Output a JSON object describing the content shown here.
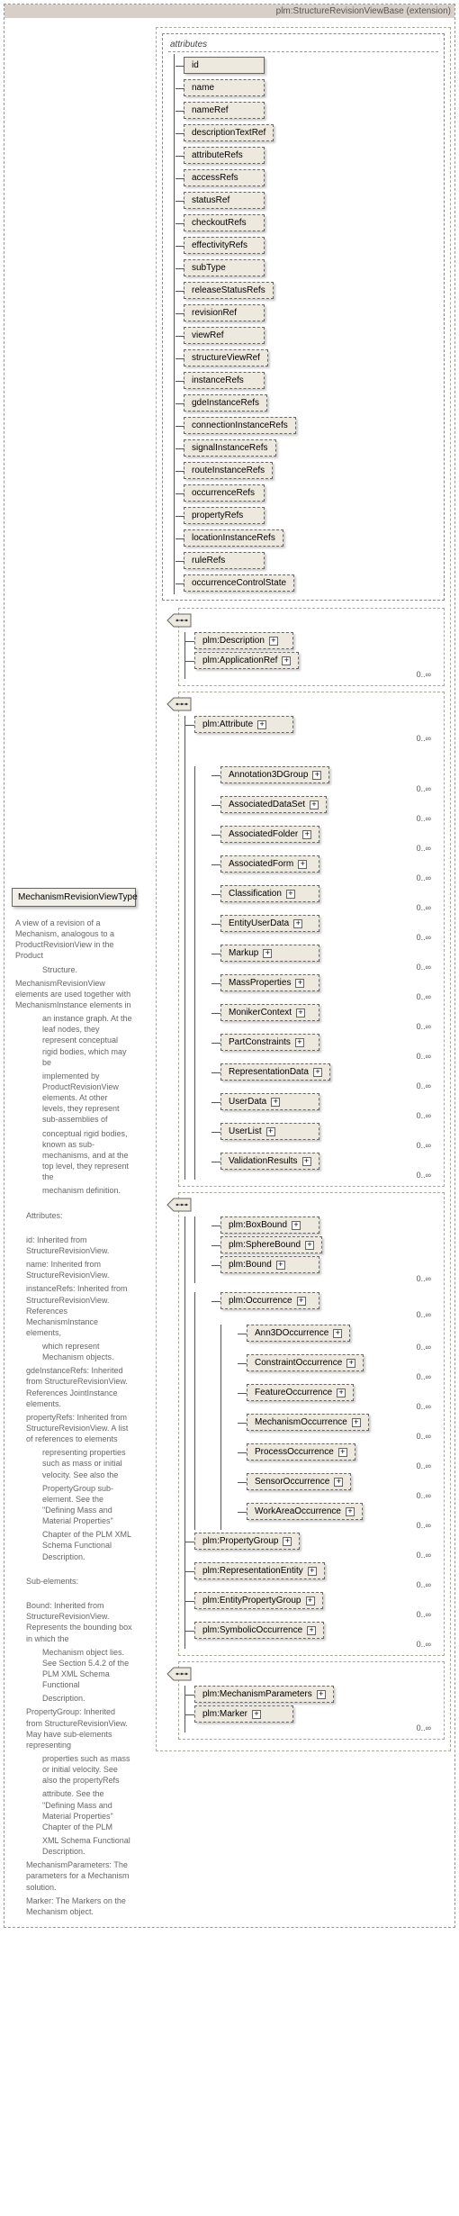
{
  "extension_label": "plm:StructureRevisionViewBase (extension)",
  "type_name": "MechanismRevisionViewType",
  "desc": {
    "p1": "A view of a revision of a Mechanism, analogous to a ProductRevisionView in the Product",
    "p1b": "Structure.",
    "p2": "MechanismRevisionView elements are used together with MechanismInstance elements in",
    "p2b": "an instance graph. At the leaf nodes, they represent conceptual rigid bodies, which may be",
    "p2c": "implemented by ProductRevisionView elements. At other levels, they represent sub-assemblies of",
    "p2d": "conceptual rigid bodies, known as sub-mechanisms, and at the top level, they represent the",
    "p2e": "mechanism definition.",
    "attr_header": "Attributes:",
    "a_id": "id:            Inherited from StructureRevisionView.",
    "a_name": "name:          Inherited from StructureRevisionView.",
    "a_inst": "instanceRefs:  Inherited from StructureRevisionView. References MechanismInstance elements,",
    "a_inst2": "which represent Mechanism objects.",
    "a_gde": "gdeInstanceRefs: Inherited from StructureRevisionView. References JointInstance elements.",
    "a_prop": "propertyRefs:  Inherited from StructureRevisionView. A list of references to elements",
    "a_prop2": "representing properties such as mass or initial velocity. See also the",
    "a_prop3": "PropertyGroup sub-element. See the \"Defining Mass and Material Properties\"",
    "a_prop4": "Chapter of the PLM XML Schema Functional Description.",
    "sub_header": "Sub-elements:",
    "s_bound": "Bound:         Inherited from StructureRevisionView. Represents the bounding box in which the",
    "s_bound2": "Mechanism object lies. See Section 5.4.2 of the PLM XML Schema Functional",
    "s_bound3": "Description.",
    "s_pg": "PropertyGroup: Inherited from StructureRevisionView. May have sub-elements representing",
    "s_pg2": "properties such as mass or initial velocity. See also the propertyRefs",
    "s_pg3": "attribute. See the \"Defining Mass and  Material Properties\" Chapter of the PLM",
    "s_pg4": "XML Schema Functional Description.",
    "s_mp": "MechanismParameters: The parameters for a Mechanism solution.",
    "s_mk": "Marker:        The Markers on the Mechanism object."
  },
  "attributes_title": "attributes",
  "attrs": {
    "id": "id",
    "name": "name",
    "nameRef": "nameRef",
    "descriptionTextRef": "descriptionTextRef",
    "attributeRefs": "attributeRefs",
    "accessRefs": "accessRefs",
    "statusRef": "statusRef",
    "checkoutRefs": "checkoutRefs",
    "effectivityRefs": "effectivityRefs",
    "subType": "subType",
    "releaseStatusRefs": "releaseStatusRefs",
    "revisionRef": "revisionRef",
    "viewRef": "viewRef",
    "structureViewRef": "structureViewRef",
    "instanceRefs": "instanceRefs",
    "gdeInstanceRefs": "gdeInstanceRefs",
    "connectionInstanceRefs": "connectionInstanceRefs",
    "signalInstanceRefs": "signalInstanceRefs",
    "routeInstanceRefs": "routeInstanceRefs",
    "occurrenceRefs": "occurrenceRefs",
    "propertyRefs": "propertyRefs",
    "locationInstanceRefs": "locationInstanceRefs",
    "ruleRefs": "ruleRefs",
    "occurrenceControlState": "occurrenceControlState"
  },
  "els": {
    "Description": "plm:Description",
    "ApplicationRef": "plm:ApplicationRef",
    "Attribute": "plm:Attribute",
    "Annotation3DGroup": "Annotation3DGroup",
    "AssociatedDataSet": "AssociatedDataSet",
    "AssociatedFolder": "AssociatedFolder",
    "AssociatedForm": "AssociatedForm",
    "Classification": "Classification",
    "EntityUserData": "EntityUserData",
    "Markup": "Markup",
    "MassProperties": "MassProperties",
    "MonikerContext": "MonikerContext",
    "PartConstraints": "PartConstraints",
    "RepresentationData": "RepresentationData",
    "UserData": "UserData",
    "UserList": "UserList",
    "ValidationResults": "ValidationResults",
    "BoxBound": "plm:BoxBound",
    "SphereBound": "plm:SphereBound",
    "Bound": "plm:Bound",
    "Occurrence": "plm:Occurrence",
    "Ann3DOccurrence": "Ann3DOccurrence",
    "ConstraintOccurrence": "ConstraintOccurrence",
    "FeatureOccurrence": "FeatureOccurrence",
    "MechanismOccurrence": "MechanismOccurrence",
    "ProcessOccurrence": "ProcessOccurrence",
    "SensorOccurrence": "SensorOccurrence",
    "WorkAreaOccurrence": "WorkAreaOccurrence",
    "PropertyGroup": "plm:PropertyGroup",
    "RepresentationEntity": "plm:RepresentationEntity",
    "EntityPropertyGroup": "plm:EntityPropertyGroup",
    "SymbolicOccurrence": "plm:SymbolicOccurrence",
    "MechanismParameters": "plm:MechanismParameters",
    "Marker": "plm:Marker"
  },
  "occ": {
    "zero_inf": "0..∞",
    "zero_one_inf": "0..∞"
  }
}
